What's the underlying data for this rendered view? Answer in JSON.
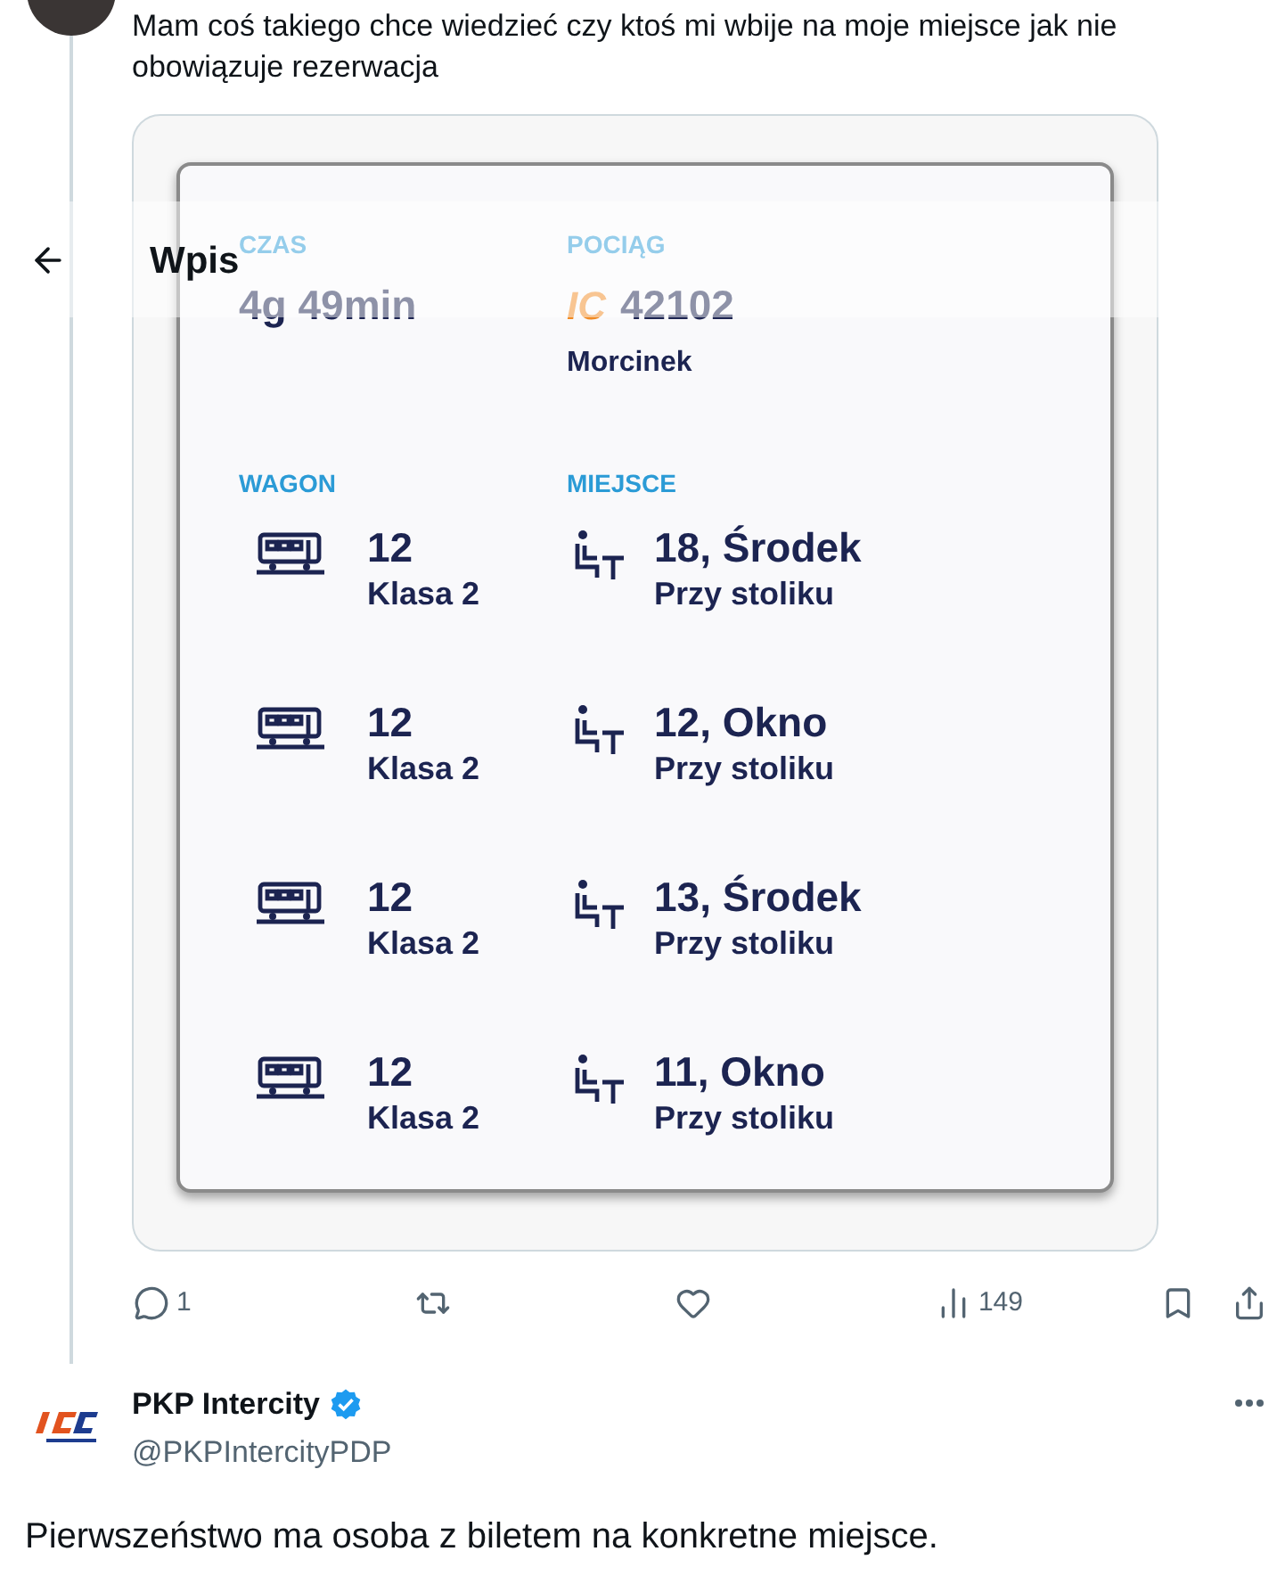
{
  "header": {
    "title": "Wpis"
  },
  "thread_post": {
    "text": "Mam coś takiego chce wiedzieć czy ktoś mi wbije na moje miejsce jak nie obowiązuje rezerwacja",
    "image": {
      "fields": [
        {
          "label": "CZAS",
          "value": "4g 49min"
        },
        {
          "label": "POCIĄG",
          "logo": "IC",
          "value": "42102",
          "subvalue": "Morcinek"
        }
      ],
      "wagon_label": "WAGON",
      "seat_label": "MIEJSCE",
      "rows": [
        {
          "wagon": "12",
          "class": "Klasa 2",
          "seat": "18, Środek",
          "seat_note": "Przy stoliku"
        },
        {
          "wagon": "12",
          "class": "Klasa 2",
          "seat": "12, Okno",
          "seat_note": "Przy stoliku"
        },
        {
          "wagon": "12",
          "class": "Klasa 2",
          "seat": "13, Środek",
          "seat_note": "Przy stoliku"
        },
        {
          "wagon": "12",
          "class": "Klasa 2",
          "seat": "11, Okno",
          "seat_note": "Przy stoliku"
        }
      ]
    },
    "actions": [
      {
        "kind": "reply",
        "count": "1"
      },
      {
        "kind": "repost"
      },
      {
        "kind": "like"
      },
      {
        "kind": "views",
        "count": "149"
      },
      {
        "kind": "bookmark"
      },
      {
        "kind": "share"
      }
    ]
  },
  "reply": {
    "name": "PKP Intercity",
    "verified": true,
    "handle": "@PKPIntercityPDP",
    "text": "Pierwszeństwo ma osoba z biletem na konkretne miejsce."
  }
}
